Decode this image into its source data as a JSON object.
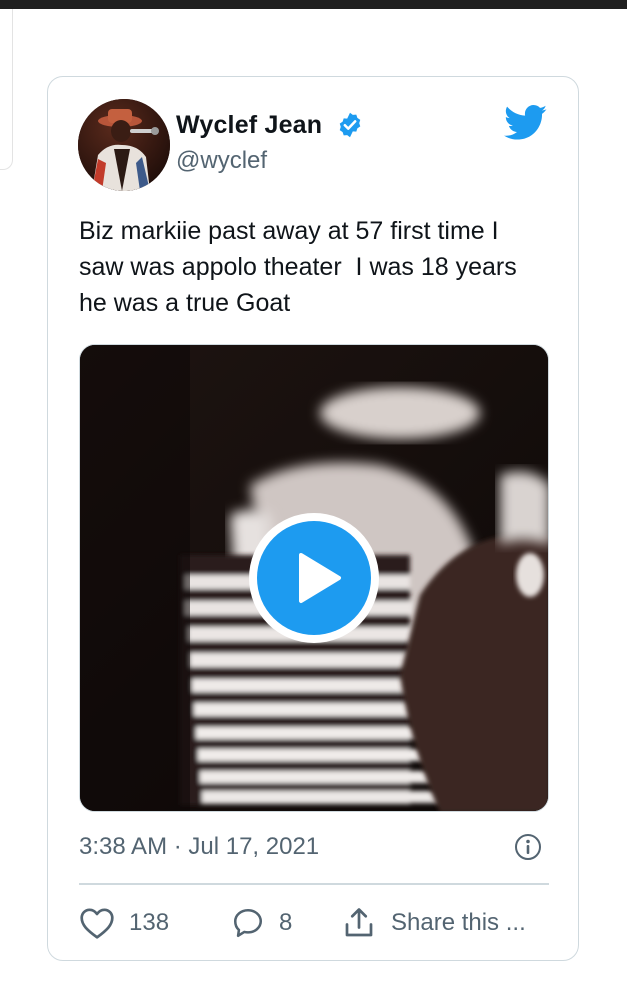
{
  "tweet": {
    "author_name": "Wyclef Jean",
    "author_handle": "@wyclef",
    "verified": true,
    "text": "Biz markiie past away at 57 first time I saw was appolo theater  I was 18 years he was a true Goat",
    "timestamp": "3:38 AM · Jul 17, 2021",
    "likes": "138",
    "replies": "8",
    "share_label": "Share this ..."
  },
  "media": {
    "type": "video",
    "play_icon": "play-icon"
  },
  "icons": {
    "brand": "twitter-bird-icon",
    "verified": "verified-badge-icon",
    "info": "info-icon",
    "like": "heart-icon",
    "reply": "reply-bubble-icon",
    "share": "share-icon"
  },
  "colors": {
    "accent": "#1d9bf0",
    "text": "#0f1419",
    "secondary": "#536471",
    "border": "#cfd9de"
  }
}
